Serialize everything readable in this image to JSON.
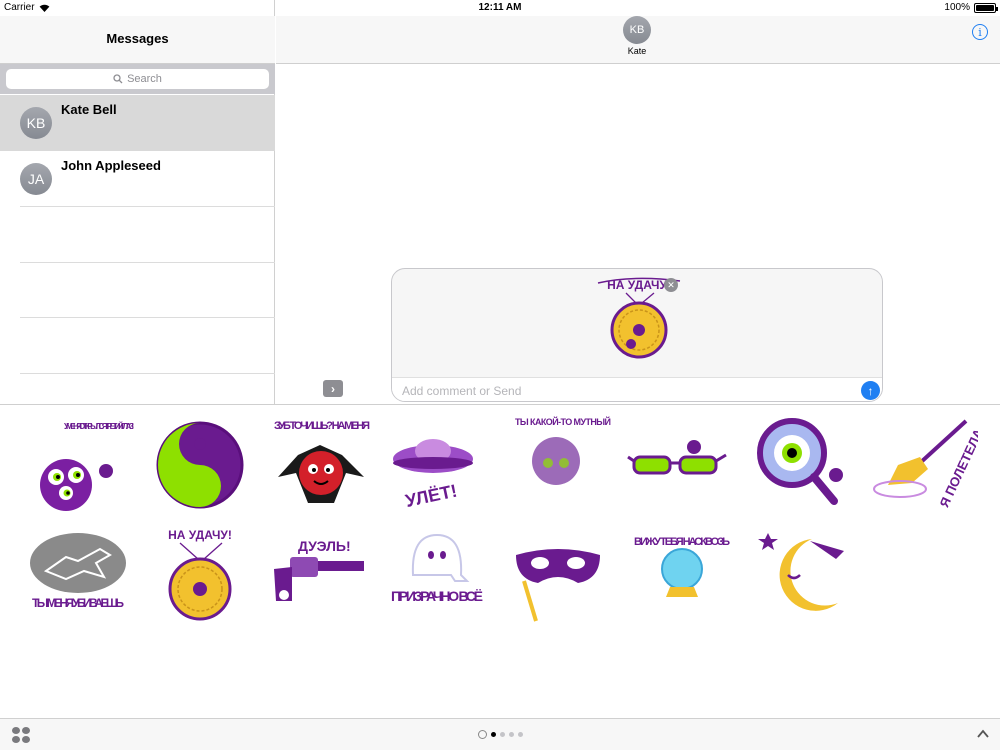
{
  "status_bar": {
    "carrier": "Carrier",
    "time": "12:11 AM",
    "battery": "100%",
    "battery_level": 1.0
  },
  "sidebar": {
    "title": "Messages",
    "search_placeholder": "Search",
    "conversations": [
      {
        "initials": "KB",
        "name": "Kate Bell",
        "selected": true
      },
      {
        "initials": "JA",
        "name": "John Appleseed",
        "selected": false
      }
    ]
  },
  "chat": {
    "contact_initials": "KB",
    "contact_name": "Kate",
    "info_icon": "info-icon",
    "compose_placeholder": "Add comment or Send",
    "staged_sticker": {
      "caption": "НА УДАЧУ!"
    }
  },
  "stickers": [
    {
      "icon": "three-eyed-monster",
      "caption": "У МЕНЯ ОТКРЫЛСЯ ТРЕТИЙ ГЛАЗ!"
    },
    {
      "icon": "yin-yang",
      "caption": ""
    },
    {
      "icon": "vampire",
      "caption": "ЗУБ ТОЧИШЬ? НА МЕНЯ"
    },
    {
      "icon": "ufo",
      "caption": "УЛЁТ!"
    },
    {
      "icon": "blurry-face",
      "caption": "ТЫ КАКОЙ-ТО МУТНЫЙ"
    },
    {
      "icon": "glasses",
      "caption": ""
    },
    {
      "icon": "magnifier-eye",
      "caption": ""
    },
    {
      "icon": "broom",
      "caption": "Я ПОЛЕТЕЛА"
    },
    {
      "icon": "chalk-outline",
      "caption": "ТЫ МЕНЯ УБИВАЕШЬ"
    },
    {
      "icon": "amulet",
      "caption": "НА УДАЧУ!"
    },
    {
      "icon": "revolver",
      "caption": "ДУЭЛЬ!"
    },
    {
      "icon": "ghost",
      "caption": "ПРИЗРАЧНО ВСЁ"
    },
    {
      "icon": "masquerade-mask",
      "caption": ""
    },
    {
      "icon": "crystal-ball",
      "caption": "ВИЖУ ТЕБЯ НАСКВОЗЬ"
    },
    {
      "icon": "moon",
      "caption": ""
    }
  ],
  "bottom_bar": {
    "pages": 4,
    "active_page": 1
  },
  "colors": {
    "accent": "#1f7ff2",
    "purple": "#6a1b8f",
    "lime": "#8ee000",
    "gold": "#f2c12e"
  }
}
